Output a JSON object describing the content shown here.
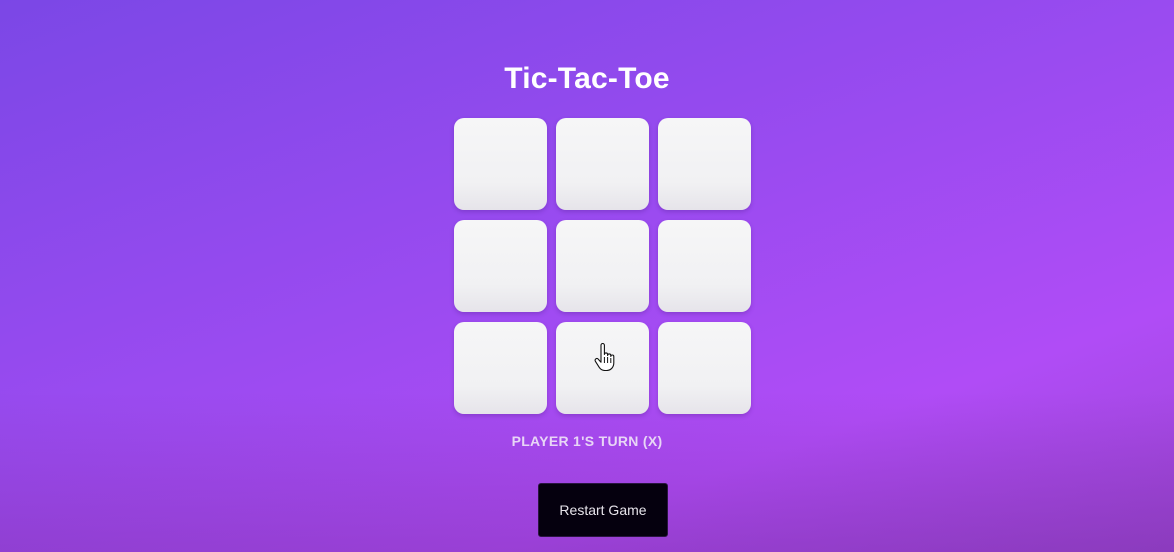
{
  "game": {
    "title": "Tic-Tac-Toe",
    "cells": [
      "",
      "",
      "",
      "",
      "",
      "",
      "",
      "",
      ""
    ],
    "status": "PLAYER 1'S TURN (X)",
    "restart_label": "Restart Game"
  },
  "pointer": {
    "icon": "hand-pointer-cursor-icon"
  },
  "colors": {
    "background_start": "#7b47e6",
    "background_end": "#b04cf6",
    "cell": "#f3f3f5",
    "button": "#05000e",
    "status_text": "#e8d6f6"
  }
}
